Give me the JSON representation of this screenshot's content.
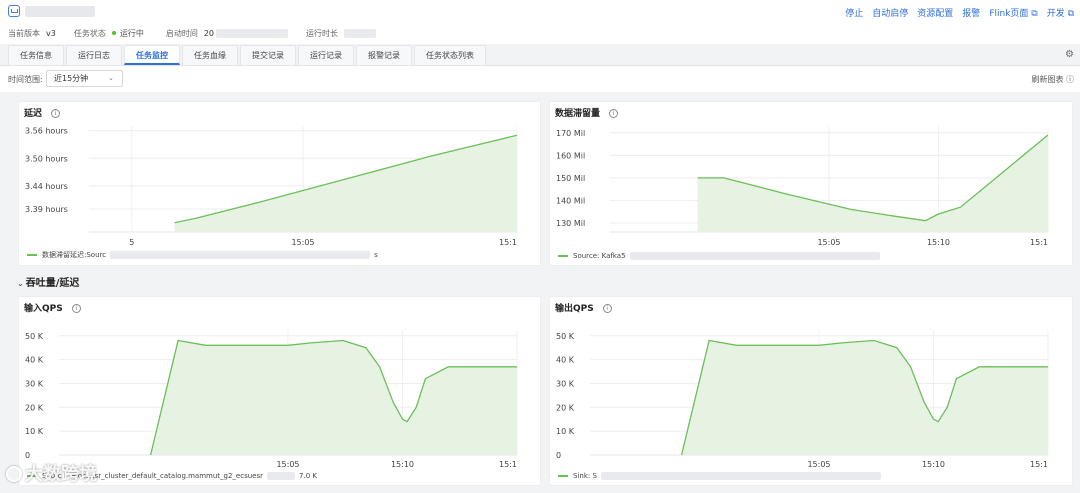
{
  "header": {
    "version_label": "当前版本",
    "version_value": "v3",
    "status_label": "任务状态",
    "status_value": "运行中",
    "start_label": "启动时间",
    "start_value": "20",
    "duration_label": "运行时长"
  },
  "actions": [
    "停止",
    "自动启停",
    "资源配置",
    "报警",
    "Flink页面 ⧉",
    "开发 ⧉"
  ],
  "tabs": [
    "任务信息",
    "运行日志",
    "任务监控",
    "任务血缘",
    "提交记录",
    "运行记录",
    "报警记录",
    "任务状态列表"
  ],
  "active_tab": "任务监控",
  "filter": {
    "label": "时间范围:",
    "value": "近15分钟",
    "refresh": "刷新图表 ⓘ"
  },
  "section": {
    "title": "吞吐量/延迟"
  },
  "watermark": {
    "text": "大数跨境"
  },
  "colors": {
    "accent": "#2f6fdb",
    "series": "#6bbf59",
    "series_fill": "#e7f3e2",
    "status_running": "#52c41a"
  },
  "chart_data": [
    {
      "type": "area",
      "title": "延迟",
      "y_ticks": [
        "3.56 hours",
        "3.50 hours",
        "3.44 hours",
        "3.39 hours"
      ],
      "y_values": [
        3.56,
        3.5,
        3.44,
        3.39
      ],
      "ylim": [
        3.34,
        3.57
      ],
      "x_ticks": [
        "5",
        "15:05",
        "15:1"
      ],
      "x": [
        0.1,
        0.5,
        1.0
      ],
      "series": [
        {
          "name": "数据滞留延迟:Source",
          "x": [
            0.2,
            0.25,
            0.4,
            0.6,
            0.8,
            1.0
          ],
          "values": [
            3.36,
            3.37,
            3.405,
            3.455,
            3.505,
            3.55
          ]
        }
      ],
      "legend": "数据滞留延迟:Sourc",
      "legend_tail": "s"
    },
    {
      "type": "area",
      "title": "数据滞留量",
      "y_ticks": [
        "170 Mil",
        "160 Mil",
        "150 Mil",
        "140 Mil",
        "130 Mil"
      ],
      "y_values": [
        170,
        160,
        150,
        140,
        130
      ],
      "ylim": [
        126,
        173
      ],
      "x_ticks": [
        "15:05",
        "15:10",
        "15:1"
      ],
      "x": [
        0.5,
        0.75,
        1.0
      ],
      "series": [
        {
          "name": "Source: Kafka",
          "x": [
            0.2,
            0.26,
            0.3,
            0.4,
            0.55,
            0.65,
            0.72,
            0.75,
            0.8,
            0.9,
            1.0
          ],
          "values": [
            150,
            150,
            148,
            143,
            136,
            133,
            131,
            134,
            137,
            153,
            169
          ]
        }
      ],
      "legend": "Source: Kafka5"
    },
    {
      "type": "area",
      "title": "输入QPS",
      "y_ticks": [
        "50 K",
        "40 K",
        "30 K",
        "20 K",
        "10 K",
        "0"
      ],
      "y_values": [
        50,
        40,
        30,
        20,
        10,
        0
      ],
      "ylim": [
        0,
        52
      ],
      "x_ticks": [
        "15:05",
        "15:10",
        "15:1"
      ],
      "x": [
        0.5,
        0.75,
        1.0
      ],
      "series": [
        {
          "name": "Source",
          "x": [
            0.2,
            0.26,
            0.32,
            0.4,
            0.5,
            0.55,
            0.62,
            0.67,
            0.7,
            0.73,
            0.75,
            0.76,
            0.78,
            0.8,
            0.85,
            0.9,
            0.95,
            1.0
          ],
          "values": [
            0,
            48,
            46,
            46,
            46,
            47,
            48,
            45,
            37,
            22,
            15,
            14,
            20,
            32,
            37,
            37,
            37,
            37
          ]
        }
      ],
      "legend": "Sourc",
      "legend_mid": "ecosuesr_cluster_default_catalog.mammut_g2_ecsuesr",
      "legend_tail": "7.0 K"
    },
    {
      "type": "area",
      "title": "输出QPS",
      "y_ticks": [
        "50 K",
        "40 K",
        "30 K",
        "20 K",
        "10 K",
        "0"
      ],
      "y_values": [
        50,
        40,
        30,
        20,
        10,
        0
      ],
      "ylim": [
        0,
        52
      ],
      "x_ticks": [
        "15:05",
        "15:10",
        "15:1"
      ],
      "x": [
        0.5,
        0.75,
        1.0
      ],
      "series": [
        {
          "name": "Sink: S",
          "x": [
            0.2,
            0.26,
            0.32,
            0.4,
            0.5,
            0.55,
            0.62,
            0.67,
            0.7,
            0.73,
            0.75,
            0.76,
            0.78,
            0.8,
            0.85,
            0.9,
            0.95,
            1.0
          ],
          "values": [
            0,
            48,
            46,
            46,
            46,
            47,
            48,
            45,
            37,
            22,
            15,
            14,
            20,
            32,
            37,
            37,
            37,
            37
          ]
        }
      ],
      "legend": "Sink: S"
    }
  ]
}
